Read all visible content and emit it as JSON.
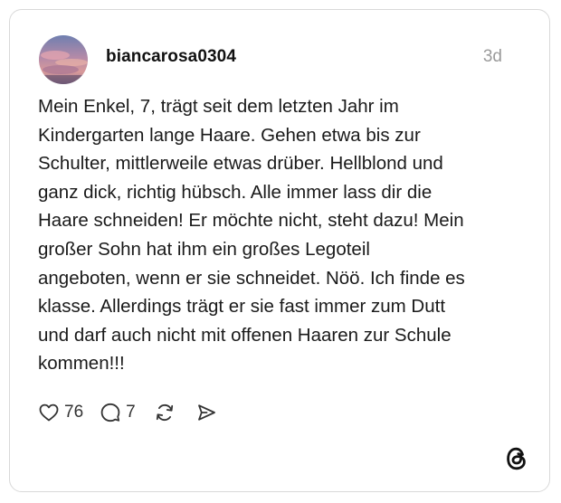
{
  "post": {
    "username": "biancarosa0304",
    "timestamp": "3d",
    "text": "Mein Enkel, 7, trägt seit dem letzten Jahr im\nKindergarten lange Haare. Gehen etwa bis zur\nSchulter, mittlerweile etwas drüber. Hellblond und\nganz dick, richtig hübsch. Alle immer lass dir die\nHaare schneiden! Er möchte nicht, steht dazu! Mein\ngroßer Sohn hat ihm ein großes Legoteil\nangeboten, wenn er sie schneidet. Nöö. Ich finde es\nklasse. Allerdings trägt er sie fast immer zum Dutt\nund darf auch nicht mit offenen Haaren zur Schule\nkommen!!!"
  },
  "actions": {
    "likes": "76",
    "replies": "7"
  },
  "icons": {
    "like": "heart-icon",
    "reply": "comment-icon",
    "repost": "repost-icon",
    "share": "send-icon",
    "brand": "threads-logo-icon"
  },
  "colors": {
    "border": "#d9d9d9",
    "text": "#1a1a1a",
    "muted": "#9a9a9a"
  }
}
